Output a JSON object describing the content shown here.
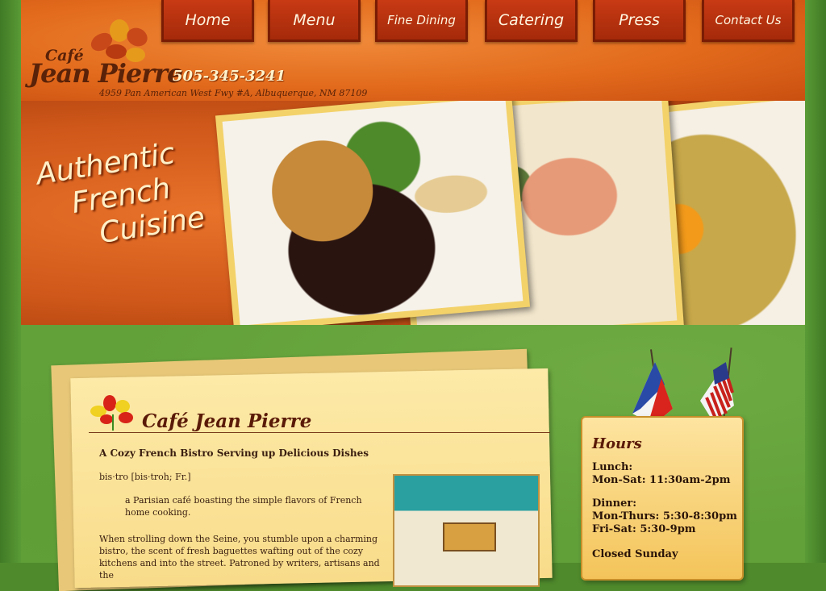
{
  "brand": {
    "logo_top": "Café",
    "logo_main": "Jean Pierre",
    "phone": "505-345-3241",
    "address": "4959 Pan American West Fwy #A, Albuquerque, NM 87109"
  },
  "nav": {
    "items": [
      {
        "label": "Home"
      },
      {
        "label": "Menu"
      },
      {
        "label": "Fine Dining"
      },
      {
        "label": "Catering"
      },
      {
        "label": "Press"
      },
      {
        "label": "Contact Us"
      }
    ]
  },
  "hero": {
    "tagline": [
      "Authentic",
      "French",
      "Cuisine"
    ]
  },
  "main": {
    "title": "Café Jean Pierre",
    "subtitle": "A Cozy French Bistro Serving up Delicious Dishes",
    "definition": "bis·tro [bis·troh; Fr.]",
    "definition_body": "a Parisian café boasting the simple flavors of French home cooking.",
    "paragraph": "When strolling down the Seine, you stumble upon a charming bistro, the scent of fresh baguettes wafting out of the cozy kitchens and into the street. Patroned by writers, artisans and the"
  },
  "hours": {
    "title": "Hours",
    "lunch_label": "Lunch:",
    "lunch_time": "Mon-Sat: 11:30am-2pm",
    "dinner_label": "Dinner:",
    "dinner_weekday": "Mon-Thurs: 5:30-8:30pm",
    "dinner_weekend": "Fri-Sat: 5:30-9pm",
    "closed": "Closed Sunday"
  },
  "colors": {
    "header_orange": "#e26a1c",
    "nav_red": "#b83212",
    "green": "#62a03a",
    "paper": "#fbe39a",
    "text_brown": "#5a1a08"
  }
}
